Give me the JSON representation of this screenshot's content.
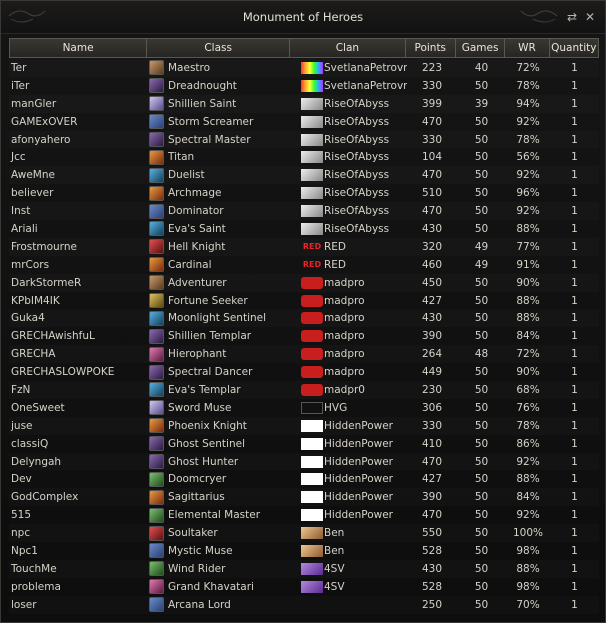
{
  "window": {
    "title": "Monument of Heroes",
    "refresh_icon": "refresh-icon",
    "close_icon": "close-icon"
  },
  "columns": {
    "name": "Name",
    "class": "Class",
    "clan": "Clan",
    "points": "Points",
    "games": "Games",
    "wr": "WR",
    "quantity": "Quantity"
  },
  "rows": [
    {
      "name": "Ter",
      "class": "Maestro",
      "class_icon": "cc-fighter",
      "clan": "SvetlanaPetrovn",
      "clan_icon": "ce-rainbow",
      "clan_mark": "",
      "points": "223",
      "games": "40",
      "wr": "72%",
      "quantity": "1"
    },
    {
      "name": "iTer",
      "class": "Dreadnought",
      "class_icon": "cc-dark",
      "clan": "SvetlanaPetrovn",
      "clan_icon": "ce-rainbow",
      "clan_mark": "",
      "points": "330",
      "games": "50",
      "wr": "78%",
      "quantity": "1"
    },
    {
      "name": "manGler",
      "class": "Shillien Saint",
      "class_icon": "cc-healer",
      "clan": "RiseOfAbyss",
      "clan_icon": "ce-rise",
      "clan_mark": "",
      "points": "399",
      "games": "39",
      "wr": "94%",
      "quantity": "1"
    },
    {
      "name": "GAMExOVER",
      "class": "Storm Screamer",
      "class_icon": "cc-mage",
      "clan": "RiseOfAbyss",
      "clan_icon": "ce-rise",
      "clan_mark": "",
      "points": "470",
      "games": "50",
      "wr": "92%",
      "quantity": "1"
    },
    {
      "name": "afonyahero",
      "class": "Spectral Master",
      "class_icon": "cc-dark",
      "clan": "RiseOfAbyss",
      "clan_icon": "ce-rise",
      "clan_mark": "",
      "points": "330",
      "games": "50",
      "wr": "78%",
      "quantity": "1"
    },
    {
      "name": "Jcc",
      "class": "Titan",
      "class_icon": "cc-fire",
      "clan": "RiseOfAbyss",
      "clan_icon": "ce-rise",
      "clan_mark": "",
      "points": "104",
      "games": "50",
      "wr": "56%",
      "quantity": "1"
    },
    {
      "name": "AweMne",
      "class": "Duelist",
      "class_icon": "cc-blue",
      "clan": "RiseOfAbyss",
      "clan_icon": "ce-rise",
      "clan_mark": "",
      "points": "470",
      "games": "50",
      "wr": "92%",
      "quantity": "1"
    },
    {
      "name": "believer",
      "class": "Archmage",
      "class_icon": "cc-fire",
      "clan": "RiseOfAbyss",
      "clan_icon": "ce-rise",
      "clan_mark": "",
      "points": "510",
      "games": "50",
      "wr": "96%",
      "quantity": "1"
    },
    {
      "name": "Inst",
      "class": "Dominator",
      "class_icon": "cc-mage",
      "clan": "RiseOfAbyss",
      "clan_icon": "ce-rise",
      "clan_mark": "",
      "points": "470",
      "games": "50",
      "wr": "92%",
      "quantity": "1"
    },
    {
      "name": "Ariali",
      "class": "Eva's Saint",
      "class_icon": "cc-blue",
      "clan": "RiseOfAbyss",
      "clan_icon": "ce-rise",
      "clan_mark": "",
      "points": "430",
      "games": "50",
      "wr": "88%",
      "quantity": "1"
    },
    {
      "name": "Frostmourne",
      "class": "Hell Knight",
      "class_icon": "cc-red",
      "clan": "RED",
      "clan_icon": "ce-red",
      "clan_mark": "RED",
      "points": "320",
      "games": "49",
      "wr": "77%",
      "quantity": "1"
    },
    {
      "name": "mrCors",
      "class": "Cardinal",
      "class_icon": "cc-fire",
      "clan": "RED",
      "clan_icon": "ce-red",
      "clan_mark": "RED",
      "points": "460",
      "games": "49",
      "wr": "91%",
      "quantity": "1"
    },
    {
      "name": "DarkStormeR",
      "class": "Adventurer",
      "class_icon": "cc-fighter",
      "clan": "madpro",
      "clan_icon": "ce-mad",
      "clan_mark": "",
      "points": "450",
      "games": "50",
      "wr": "90%",
      "quantity": "1"
    },
    {
      "name": "KPbIM4IK",
      "class": "Fortune Seeker",
      "class_icon": "cc-gold",
      "clan": "madpro",
      "clan_icon": "ce-mad",
      "clan_mark": "",
      "points": "427",
      "games": "50",
      "wr": "88%",
      "quantity": "1"
    },
    {
      "name": "Guka4",
      "class": "Moonlight Sentinel",
      "class_icon": "cc-blue",
      "clan": "madpro",
      "clan_icon": "ce-mad",
      "clan_mark": "",
      "points": "430",
      "games": "50",
      "wr": "88%",
      "quantity": "1"
    },
    {
      "name": "GRECHAwishfuL",
      "class": "Shillien Templar",
      "class_icon": "cc-dark",
      "clan": "madpro",
      "clan_icon": "ce-mad",
      "clan_mark": "",
      "points": "390",
      "games": "50",
      "wr": "84%",
      "quantity": "1"
    },
    {
      "name": "GRECHA",
      "class": "Hierophant",
      "class_icon": "cc-pink",
      "clan": "madpro",
      "clan_icon": "ce-mad",
      "clan_mark": "",
      "points": "264",
      "games": "48",
      "wr": "72%",
      "quantity": "1"
    },
    {
      "name": "GRECHASLOWPOKE",
      "class": "Spectral Dancer",
      "class_icon": "cc-dark",
      "clan": "madpro",
      "clan_icon": "ce-mad",
      "clan_mark": "",
      "points": "449",
      "games": "50",
      "wr": "90%",
      "quantity": "1"
    },
    {
      "name": "FzN",
      "class": "Eva's Templar",
      "class_icon": "cc-blue",
      "clan": "madpr0",
      "clan_icon": "ce-mad",
      "clan_mark": "",
      "points": "230",
      "games": "50",
      "wr": "68%",
      "quantity": "1"
    },
    {
      "name": "OneSweet",
      "class": "Sword Muse",
      "class_icon": "cc-healer",
      "clan": "HVG",
      "clan_icon": "ce-hvg",
      "clan_mark": "",
      "points": "306",
      "games": "50",
      "wr": "76%",
      "quantity": "1"
    },
    {
      "name": "juse",
      "class": "Phoenix Knight",
      "class_icon": "cc-fire",
      "clan": "HiddenPower",
      "clan_icon": "ce-hidden",
      "clan_mark": "",
      "points": "330",
      "games": "50",
      "wr": "78%",
      "quantity": "1"
    },
    {
      "name": "classiQ",
      "class": "Ghost Sentinel",
      "class_icon": "cc-dark",
      "clan": "HiddenPower",
      "clan_icon": "ce-hidden",
      "clan_mark": "",
      "points": "410",
      "games": "50",
      "wr": "86%",
      "quantity": "1"
    },
    {
      "name": "Delyngah",
      "class": "Ghost Hunter",
      "class_icon": "cc-dark",
      "clan": "HiddenPower",
      "clan_icon": "ce-hidden",
      "clan_mark": "",
      "points": "470",
      "games": "50",
      "wr": "92%",
      "quantity": "1"
    },
    {
      "name": "Dev",
      "class": "Doomcryer",
      "class_icon": "cc-green",
      "clan": "HiddenPower",
      "clan_icon": "ce-hidden",
      "clan_mark": "",
      "points": "427",
      "games": "50",
      "wr": "88%",
      "quantity": "1"
    },
    {
      "name": "GodComplex",
      "class": "Sagittarius",
      "class_icon": "cc-fire",
      "clan": "HiddenPower",
      "clan_icon": "ce-hidden",
      "clan_mark": "",
      "points": "390",
      "games": "50",
      "wr": "84%",
      "quantity": "1"
    },
    {
      "name": "515",
      "class": "Elemental Master",
      "class_icon": "cc-green",
      "clan": "HiddenPower",
      "clan_icon": "ce-hidden",
      "clan_mark": "",
      "points": "470",
      "games": "50",
      "wr": "92%",
      "quantity": "1"
    },
    {
      "name": "npc",
      "class": "Soultaker",
      "class_icon": "cc-red",
      "clan": "Ben",
      "clan_icon": "ce-ben",
      "clan_mark": "",
      "points": "550",
      "games": "50",
      "wr": "100%",
      "quantity": "1"
    },
    {
      "name": "Npc1",
      "class": "Mystic Muse",
      "class_icon": "cc-mage",
      "clan": "Ben",
      "clan_icon": "ce-ben",
      "clan_mark": "",
      "points": "528",
      "games": "50",
      "wr": "98%",
      "quantity": "1"
    },
    {
      "name": "TouchMe",
      "class": "Wind Rider",
      "class_icon": "cc-green",
      "clan": "4SV",
      "clan_icon": "ce-4sv",
      "clan_mark": "",
      "points": "430",
      "games": "50",
      "wr": "88%",
      "quantity": "1"
    },
    {
      "name": "problema",
      "class": "Grand Khavatari",
      "class_icon": "cc-pink",
      "clan": "4SV",
      "clan_icon": "ce-4sv",
      "clan_mark": "",
      "points": "528",
      "games": "50",
      "wr": "98%",
      "quantity": "1"
    },
    {
      "name": "loser",
      "class": "Arcana Lord",
      "class_icon": "cc-mage",
      "clan": "",
      "clan_icon": "",
      "clan_mark": "",
      "points": "250",
      "games": "50",
      "wr": "70%",
      "quantity": "1"
    }
  ]
}
